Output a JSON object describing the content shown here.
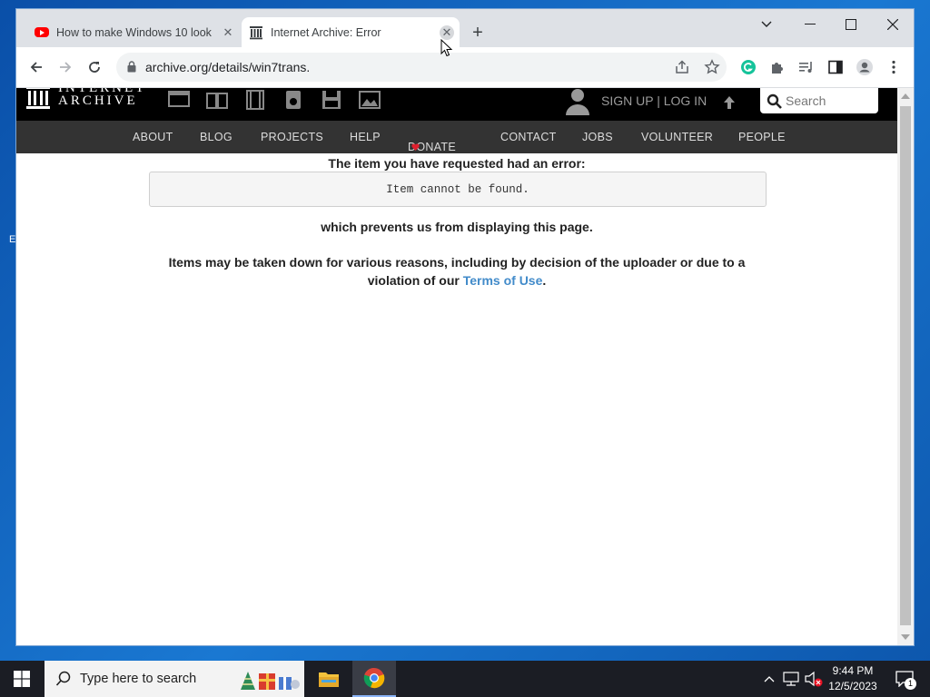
{
  "browser": {
    "tabs": [
      {
        "title": "How to make Windows 10 look",
        "icon": "youtube-icon",
        "active": false
      },
      {
        "title": "Internet Archive: Error",
        "icon": "archive-icon",
        "active": true
      }
    ],
    "url": "archive.org/details/win7trans."
  },
  "archive": {
    "logo_line1": "INTERNET",
    "logo_line2": "ARCHIVE",
    "signup_login": "SIGN UP | LOG IN",
    "search_placeholder": "Search",
    "nav": [
      "ABOUT",
      "BLOG",
      "PROJECTS",
      "HELP",
      "DONATE",
      "CONTACT",
      "JOBS",
      "VOLUNTEER",
      "PEOPLE"
    ],
    "donate_heart_color": "#e0202e"
  },
  "error": {
    "heading": "The item you have requested had an error:",
    "message": "Item cannot be found.",
    "prevents": "which prevents us from displaying this page.",
    "reason_line1": "Items may be taken down for various reasons, including by decision of the uploader or due to a",
    "reason_line2_prefix": "violation of our",
    "terms_link": "Terms of Use",
    "reason_line2_suffix": "."
  },
  "taskbar": {
    "search_placeholder": "Type here to search",
    "time": "9:44 PM",
    "date": "12/5/2023",
    "notification_count": "1"
  }
}
